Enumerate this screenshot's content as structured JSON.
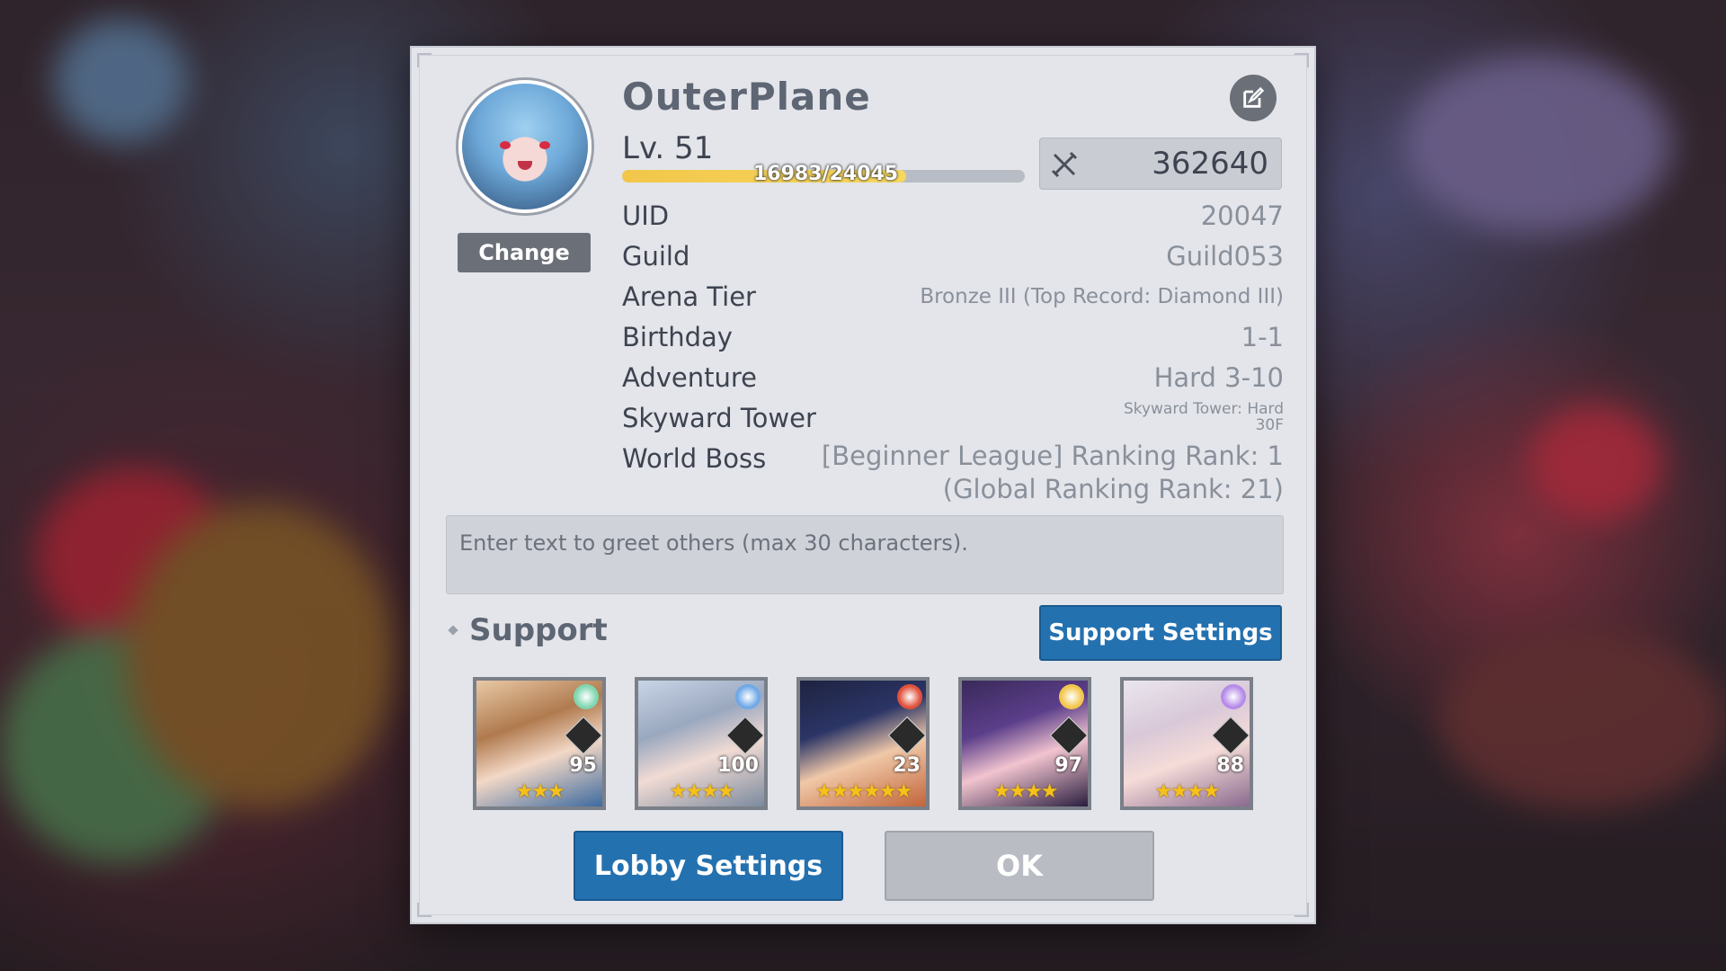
{
  "profile": {
    "name": "OuterPlane",
    "level": "Lv. 51",
    "xp_text": "16983/24045",
    "xp_current": 16983,
    "xp_max": 24045,
    "power": "362640",
    "change_label": "Change"
  },
  "info": [
    {
      "label": "UID",
      "value": "20047"
    },
    {
      "label": "Guild",
      "value": "Guild053"
    },
    {
      "label": "Arena Tier",
      "value": "Bronze III (Top Record: Diamond III)"
    },
    {
      "label": "Birthday",
      "value": "1-1"
    },
    {
      "label": "Adventure",
      "value": "Hard 3-10"
    },
    {
      "label": "Skyward Tower",
      "value_line1": "Skyward Tower: Hard",
      "value_line2": "30F"
    },
    {
      "label": "World Boss",
      "value_line1": "[Beginner League] Ranking Rank: 1",
      "value_line2": "(Global Ranking Rank: 21)"
    }
  ],
  "greeting": {
    "placeholder": "Enter text to greet others (max 30 characters)."
  },
  "support": {
    "title": "Support",
    "settings_label": "Support Settings",
    "heroes": [
      {
        "level": "95",
        "stars": "★★★",
        "element_color": "#7fd6b0",
        "class_icon": "mage-class-icon"
      },
      {
        "level": "100",
        "stars": "★★★★",
        "element_color": "#6fa8e8",
        "class_icon": "healer-class-icon"
      },
      {
        "level": "23",
        "stars": "★★★★★★",
        "element_color": "#e0503a",
        "class_icon": "defender-class-icon"
      },
      {
        "level": "97",
        "stars": "★★★★",
        "element_color": "#f2c64a",
        "class_icon": "ranger-class-icon"
      },
      {
        "level": "88",
        "stars": "★★★★",
        "element_color": "#b58ae8",
        "class_icon": "mage-class-icon"
      }
    ]
  },
  "buttons": {
    "lobby_settings": "Lobby Settings",
    "ok": "OK"
  },
  "colors": {
    "primary_button": "#2471b0",
    "panel_bg": "#e3e5ea",
    "xp_fill": "#f2c64a",
    "star": "#f5c21a"
  }
}
